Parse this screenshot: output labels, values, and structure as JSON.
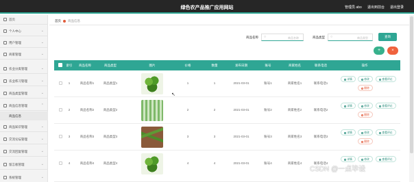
{
  "header": {
    "title": "绿色农产品推广应用网站",
    "admin_label": "管理员 abo",
    "exit_label": "退出到前台",
    "logout_label": "退出登录",
    "bg_color": "#262626",
    "accent_color": "#2fa694"
  },
  "sidebar": {
    "items": [
      {
        "label": "首页",
        "icon": "home-icon"
      },
      {
        "label": "个人中心",
        "icon": "user-icon"
      },
      {
        "label": "用户管理",
        "icon": "users-icon"
      },
      {
        "label": "商家管理",
        "icon": "shop-icon"
      },
      {
        "label": "农业分类管理",
        "icon": "grid-icon"
      },
      {
        "label": "农业练习管理",
        "icon": "list-icon"
      },
      {
        "label": "商品类型管理",
        "icon": "tag-icon"
      },
      {
        "label": "商品信息管理",
        "icon": "box-icon"
      },
      {
        "label": "商品知识管理",
        "icon": "book-icon"
      },
      {
        "label": "交流论坛管理",
        "icon": "chat-icon"
      },
      {
        "label": "交流回复管理",
        "icon": "reply-icon"
      },
      {
        "label": "留言板管理",
        "icon": "message-icon"
      },
      {
        "label": "系统管理",
        "icon": "gear-icon"
      }
    ],
    "active_sub": "商品信息"
  },
  "breadcrumb": {
    "home": "首页",
    "current": "商品信息"
  },
  "filters": {
    "name_label": "商品名称",
    "name_placeholder": "商品名称",
    "type_label": "商品类型",
    "type_placeholder": "商品类型",
    "search_label": "查询",
    "add_label": "+",
    "delete_label": "×"
  },
  "table": {
    "headers": [
      "索引",
      "商品名称",
      "商品类型",
      "图片",
      "价格",
      "数量",
      "发布日期",
      "账号",
      "商家姓名",
      "联系电话",
      "操作"
    ],
    "rows": [
      {
        "index": "1",
        "name": "商品名称1",
        "type": "商品类型1",
        "price": "1",
        "qty": "1",
        "date": "2021-03-01",
        "account": "账号1",
        "merchant": "商家姓名1",
        "phone": "联系电话1",
        "img": "broccoli"
      },
      {
        "index": "2",
        "name": "商品名称2",
        "type": "商品类型2",
        "price": "2",
        "qty": "2",
        "date": "2021-03-01",
        "account": "账号2",
        "merchant": "商家姓名2",
        "phone": "联系电话2",
        "img": "greenhouse"
      },
      {
        "index": "3",
        "name": "商品名称3",
        "type": "商品类型3",
        "price": "3",
        "qty": "3",
        "date": "2021-03-01",
        "account": "账号3",
        "merchant": "商家姓名3",
        "phone": "联系电话3",
        "img": "cucumber"
      },
      {
        "index": "4",
        "name": "商品名称4",
        "type": "商品类型4",
        "price": "4",
        "qty": "4",
        "date": "2021-03-01",
        "account": "账号4",
        "merchant": "商家姓名4",
        "phone": "联系电话4",
        "img": "broccoli"
      }
    ],
    "actions": {
      "view": "详情",
      "edit": "修改",
      "review": "查看评论",
      "delete": "删除"
    }
  },
  "watermark": "CSDN @一点毕设"
}
